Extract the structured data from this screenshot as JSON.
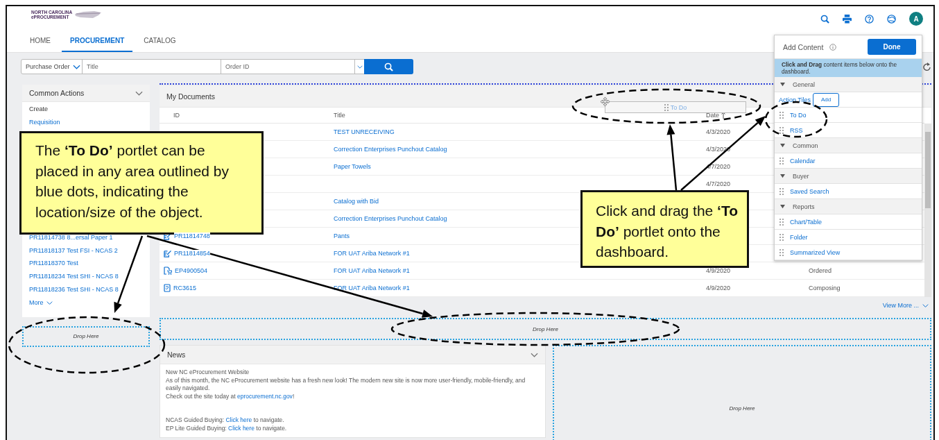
{
  "header": {
    "logo": {
      "line_1": "NORTH CAROLINA",
      "line_2": "ePROCUREMENT"
    },
    "avatar": "A"
  },
  "tabs": [
    {
      "label": "HOME",
      "selected": false
    },
    {
      "label": "PROCUREMENT",
      "selected": true
    },
    {
      "label": "CATALOG",
      "selected": false
    }
  ],
  "search": {
    "document_type": "Purchase Order",
    "title_placeholder": "Title",
    "id_placeholder": "Order ID"
  },
  "common_actions": {
    "title": "Common Actions",
    "create_label": "Create",
    "create_links": [
      "Requisition"
    ],
    "recent": [
      "PR11814738 8...ersal Paper 1",
      "PR11818137 Test FSI - NCAS 2",
      "PR11818370 Test",
      "PR11818234 Test SHI - NCAS 8",
      "PR11818236 Test SHI - NCAS 8"
    ],
    "more": "More"
  },
  "sidebar_drop_zone": {
    "label": "Drop Here"
  },
  "my_documents": {
    "title": "My Documents",
    "columns": [
      {
        "label": "ID",
        "sorted_ascending": false
      },
      {
        "label": "Title",
        "sorted_ascending": false
      },
      {
        "label": "Date",
        "sorted_ascending": true
      }
    ],
    "rows": [
      {
        "title": "TEST UNRECEIVING",
        "date": "4/3/2020"
      },
      {
        "title": "Correction Enterprises Punchout Catalog",
        "date": "4/3/2020"
      },
      {
        "title": "Paper Towels",
        "date": "4/7/2020"
      },
      {
        "date": "4/7/2020"
      },
      {
        "title": "Catalog with Bid"
      },
      {
        "title": "Correction Enterprises Punchout Catalog"
      },
      {
        "kind": "requisition",
        "id": "PR11814748",
        "title": "Pants"
      },
      {
        "kind": "requisition",
        "id": "PR11814854",
        "title": "FOR UAT Ariba Network #1"
      },
      {
        "kind": "order",
        "id": "EP4900504",
        "title": "FOR UAT Ariba Network #1",
        "date": "4/9/2020",
        "status": "Ordered"
      },
      {
        "kind": "receipt",
        "id": "RC3615",
        "title": "FOR UAT Ariba Network #1",
        "date": "4/9/2020",
        "status": "Composing"
      }
    ],
    "view_more": "View More ..."
  },
  "wide_drop_zone": {
    "label": "Drop Here"
  },
  "news": {
    "title": "News",
    "headline": "New NC eProcurement Website",
    "body": "As of this month, the NC eProcurement website has a fresh new look! The modern new site is now more user-friendly, mobile-friendly, and easily navigated.",
    "site_line": {
      "before": "Check out the site today at ",
      "link": "eprocurement.nc.gov",
      "after": "!"
    },
    "guides": [
      {
        "before": "NCAS Guided Buying: ",
        "link": "Click here",
        "after": " to navigate."
      },
      {
        "before": "EP Lite Guided Buying: ",
        "link": "Click here",
        "after": " to navigate."
      }
    ]
  },
  "side_drop_zone": {
    "label": "Drop Here"
  },
  "add_content": {
    "title": "Add Content",
    "done": "Done",
    "instruction": "**Click and Drag** content items below onto the dashboard.",
    "groups": [
      {
        "name": "General",
        "expanded": true,
        "items": [
          {
            "label": "Action Tiles",
            "kind": "tile",
            "action": "Add"
          },
          {
            "label": "To Do",
            "kind": "item"
          },
          {
            "label": "RSS",
            "kind": "item"
          }
        ]
      },
      {
        "name": "Common",
        "expanded": true,
        "items": [
          {
            "label": "Calendar",
            "kind": "item"
          }
        ]
      },
      {
        "name": "Buyer",
        "expanded": true,
        "items": [
          {
            "label": "Saved Search",
            "kind": "item"
          }
        ]
      },
      {
        "name": "Reports",
        "expanded": true,
        "items": [
          {
            "label": "Chart/Table",
            "kind": "item"
          },
          {
            "label": "Folder",
            "kind": "item"
          },
          {
            "label": "Summarized View",
            "kind": "item"
          }
        ]
      }
    ]
  },
  "drag_ghost": {
    "label": "To Do"
  },
  "callouts": [
    {
      "text": "The **‘To Do’** portlet can be placed in any area outlined by blue dots, indicating the location/size of the object."
    },
    {
      "text": "Click and drag the **‘To Do’** portlet onto the dashboard."
    }
  ]
}
